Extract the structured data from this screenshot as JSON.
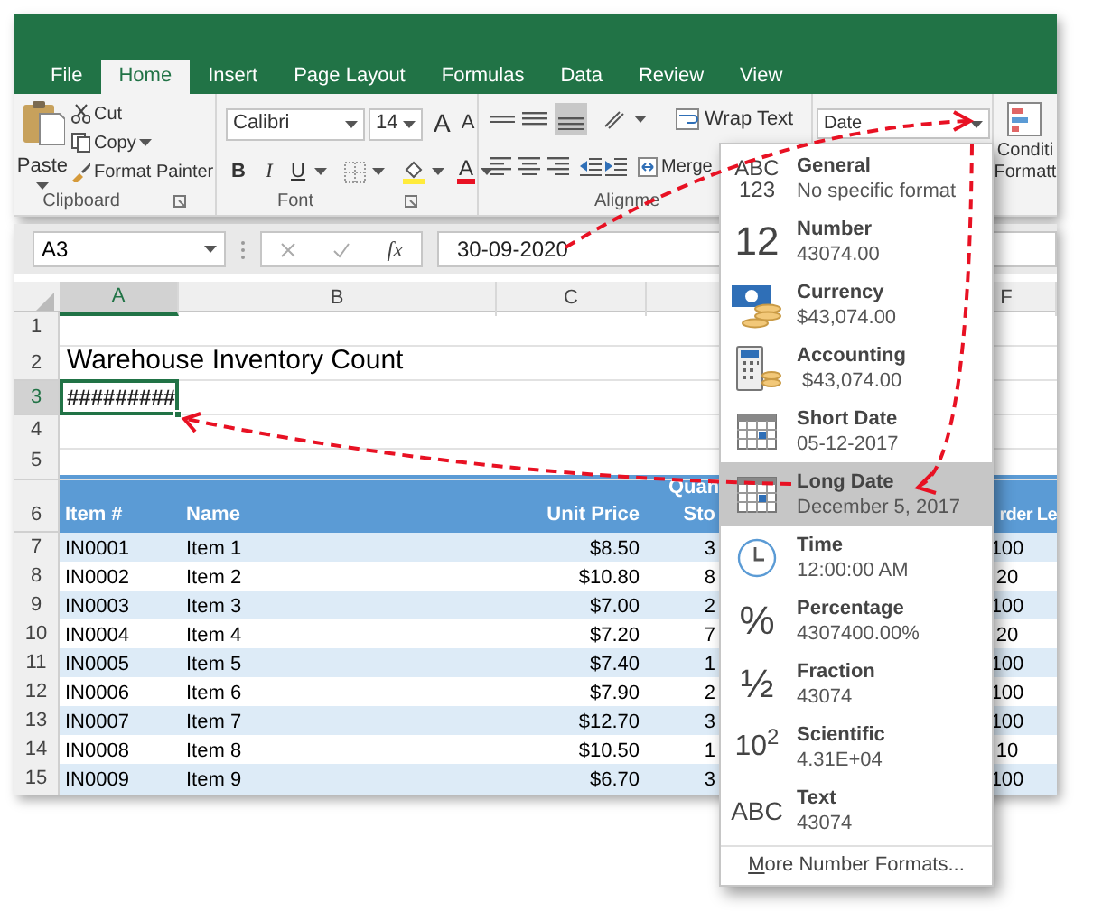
{
  "ribbon": {
    "tabs": [
      {
        "label": "File",
        "selected": false
      },
      {
        "label": "Home",
        "selected": true
      },
      {
        "label": "Insert",
        "selected": false
      },
      {
        "label": "Page Layout",
        "selected": false
      },
      {
        "label": "Formulas",
        "selected": false
      },
      {
        "label": "Data",
        "selected": false
      },
      {
        "label": "Review",
        "selected": false
      },
      {
        "label": "View",
        "selected": false
      }
    ],
    "clipboard": {
      "paste": "Paste",
      "cut": "Cut",
      "copy": "Copy",
      "format_painter": "Format Painter",
      "group_label": "Clipboard"
    },
    "font": {
      "name": "Calibri",
      "size": "14",
      "grow": "A",
      "shrink": "A",
      "bold": "B",
      "italic": "I",
      "underline": "U",
      "font_color": "A",
      "group_label": "Font"
    },
    "alignment": {
      "wrap_text": "Wrap Text",
      "merge": "Merge",
      "group_label": "Alignme"
    },
    "number_format": {
      "value": "Date"
    },
    "conditional_formatting": {
      "line_1": "Conditi",
      "line_2": "Formatt"
    }
  },
  "formula_bar": {
    "name_box": "A3",
    "fx": "fx",
    "formula": "30-09-2020"
  },
  "sheet": {
    "columns": [
      {
        "label": "A",
        "selected": true
      },
      {
        "label": "B",
        "selected": false
      },
      {
        "label": "C",
        "selected": false
      },
      {
        "label": "F",
        "selected": false
      }
    ],
    "row_numbers": [
      {
        "label": "1",
        "selected": false
      },
      {
        "label": "2",
        "selected": false
      },
      {
        "label": "3",
        "selected": true
      },
      {
        "label": "4",
        "selected": false
      },
      {
        "label": "5",
        "selected": false
      },
      {
        "label": "6",
        "selected": false
      },
      {
        "label": "7",
        "selected": false
      },
      {
        "label": "8",
        "selected": false
      },
      {
        "label": "9",
        "selected": false
      },
      {
        "label": "10",
        "selected": false
      },
      {
        "label": "11",
        "selected": false
      },
      {
        "label": "12",
        "selected": false
      },
      {
        "label": "13",
        "selected": false
      },
      {
        "label": "14",
        "selected": false
      },
      {
        "label": "15",
        "selected": false
      }
    ],
    "title": "Warehouse Inventory Count",
    "active_cell": "#########",
    "table": {
      "headers": [
        "Item #",
        "Name",
        "Unit Price",
        "Quan Sto",
        "rder Le"
      ],
      "rows": [
        [
          "IN0001",
          "Item 1",
          "$8.50",
          "3",
          "100"
        ],
        [
          "IN0002",
          "Item 2",
          "$10.80",
          "8",
          "20"
        ],
        [
          "IN0003",
          "Item 3",
          "$7.00",
          "2",
          "100"
        ],
        [
          "IN0004",
          "Item 4",
          "$7.20",
          "7",
          "20"
        ],
        [
          "IN0005",
          "Item 5",
          "$7.40",
          "1",
          "100"
        ],
        [
          "IN0006",
          "Item 6",
          "$7.90",
          "2",
          "100"
        ],
        [
          "IN0007",
          "Item 7",
          "$12.70",
          "3",
          "100"
        ],
        [
          "IN0008",
          "Item 8",
          "$10.50",
          "1",
          "10"
        ],
        [
          "IN0009",
          "Item 9",
          "$6.70",
          "3",
          "100"
        ]
      ]
    }
  },
  "format_menu": {
    "items": [
      {
        "kind": "glyph",
        "icon_lines": [
          "ABC",
          "123"
        ],
        "label": "General",
        "example": "No specific format",
        "selected": false
      },
      {
        "kind": "glyph",
        "icon_lines": [
          "12"
        ],
        "label": "Number",
        "example": "43074.00",
        "selected": false
      },
      {
        "kind": "currency",
        "label": "Currency",
        "example": "$43,074.00",
        "selected": false
      },
      {
        "kind": "accounting",
        "label": "Accounting",
        "example": " $43,074.00",
        "selected": false
      },
      {
        "kind": "calendar",
        "label": "Short Date",
        "example": "05-12-2017",
        "selected": false
      },
      {
        "kind": "calendar",
        "label": "Long Date",
        "example": "December 5, 2017",
        "selected": true
      },
      {
        "kind": "clock",
        "label": "Time",
        "example": "12:00:00 AM",
        "selected": false
      },
      {
        "kind": "glyph",
        "icon_lines": [
          "%"
        ],
        "label": "Percentage",
        "example": "4307400.00%",
        "selected": false
      },
      {
        "kind": "glyph",
        "icon_lines": [
          "½"
        ],
        "label": "Fraction",
        "example": "43074",
        "selected": false
      },
      {
        "kind": "glyph",
        "icon_lines": [
          "10$^{2}$"
        ],
        "label": "Scientific",
        "example": "4.31E+04",
        "selected": false
      },
      {
        "kind": "glyph",
        "icon_lines": [
          "ABC"
        ],
        "label": "Text",
        "example": "43074",
        "selected": false
      }
    ],
    "more": "More Number Formats..."
  }
}
